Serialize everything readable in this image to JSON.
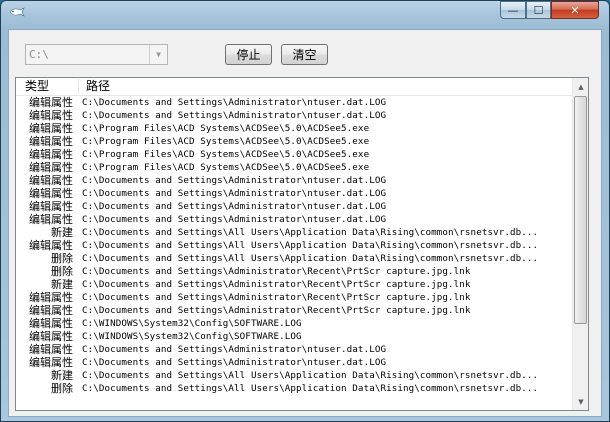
{
  "window": {
    "controls": {
      "minimize": "—",
      "maximize": "☐",
      "close": "✕"
    }
  },
  "toolbar": {
    "drive_combo": {
      "value": "C:\\"
    },
    "stop_label": "停止",
    "clear_label": "清空"
  },
  "list": {
    "columns": [
      "类型",
      "路径"
    ],
    "rows": [
      {
        "type": "编辑属性",
        "path": "C:\\Documents and Settings\\Administrator\\ntuser.dat.LOG"
      },
      {
        "type": "编辑属性",
        "path": "C:\\Documents and Settings\\Administrator\\ntuser.dat.LOG"
      },
      {
        "type": "编辑属性",
        "path": "C:\\Program Files\\ACD Systems\\ACDSee\\5.0\\ACDSee5.exe"
      },
      {
        "type": "编辑属性",
        "path": "C:\\Program Files\\ACD Systems\\ACDSee\\5.0\\ACDSee5.exe"
      },
      {
        "type": "编辑属性",
        "path": "C:\\Program Files\\ACD Systems\\ACDSee\\5.0\\ACDSee5.exe"
      },
      {
        "type": "编辑属性",
        "path": "C:\\Program Files\\ACD Systems\\ACDSee\\5.0\\ACDSee5.exe"
      },
      {
        "type": "编辑属性",
        "path": "C:\\Documents and Settings\\Administrator\\ntuser.dat.LOG"
      },
      {
        "type": "编辑属性",
        "path": "C:\\Documents and Settings\\Administrator\\ntuser.dat.LOG"
      },
      {
        "type": "编辑属性",
        "path": "C:\\Documents and Settings\\Administrator\\ntuser.dat.LOG"
      },
      {
        "type": "编辑属性",
        "path": "C:\\Documents and Settings\\Administrator\\ntuser.dat.LOG"
      },
      {
        "type": "新建",
        "path": "C:\\Documents and Settings\\All Users\\Application Data\\Rising\\common\\rsnetsvr.db..."
      },
      {
        "type": "编辑属性",
        "path": "C:\\Documents and Settings\\All Users\\Application Data\\Rising\\common\\rsnetsvr.db..."
      },
      {
        "type": "删除",
        "path": "C:\\Documents and Settings\\All Users\\Application Data\\Rising\\common\\rsnetsvr.db..."
      },
      {
        "type": "删除",
        "path": "C:\\Documents and Settings\\Administrator\\Recent\\PrtScr capture.jpg.lnk"
      },
      {
        "type": "新建",
        "path": "C:\\Documents and Settings\\Administrator\\Recent\\PrtScr capture.jpg.lnk"
      },
      {
        "type": "编辑属性",
        "path": "C:\\Documents and Settings\\Administrator\\Recent\\PrtScr capture.jpg.lnk"
      },
      {
        "type": "编辑属性",
        "path": "C:\\Documents and Settings\\Administrator\\Recent\\PrtScr capture.jpg.lnk"
      },
      {
        "type": "编辑属性",
        "path": "C:\\WINDOWS\\System32\\Config\\SOFTWARE.LOG"
      },
      {
        "type": "编辑属性",
        "path": "C:\\WINDOWS\\System32\\Config\\SOFTWARE.LOG"
      },
      {
        "type": "编辑属性",
        "path": "C:\\Documents and Settings\\Administrator\\ntuser.dat.LOG"
      },
      {
        "type": "编辑属性",
        "path": "C:\\Documents and Settings\\Administrator\\ntuser.dat.LOG"
      },
      {
        "type": "新建",
        "path": "C:\\Documents and Settings\\All Users\\Application Data\\Rising\\common\\rsnetsvr.db..."
      },
      {
        "type": "删除",
        "path": "C:\\Documents and Settings\\All Users\\Application Data\\Rising\\common\\rsnetsvr.db..."
      }
    ]
  }
}
